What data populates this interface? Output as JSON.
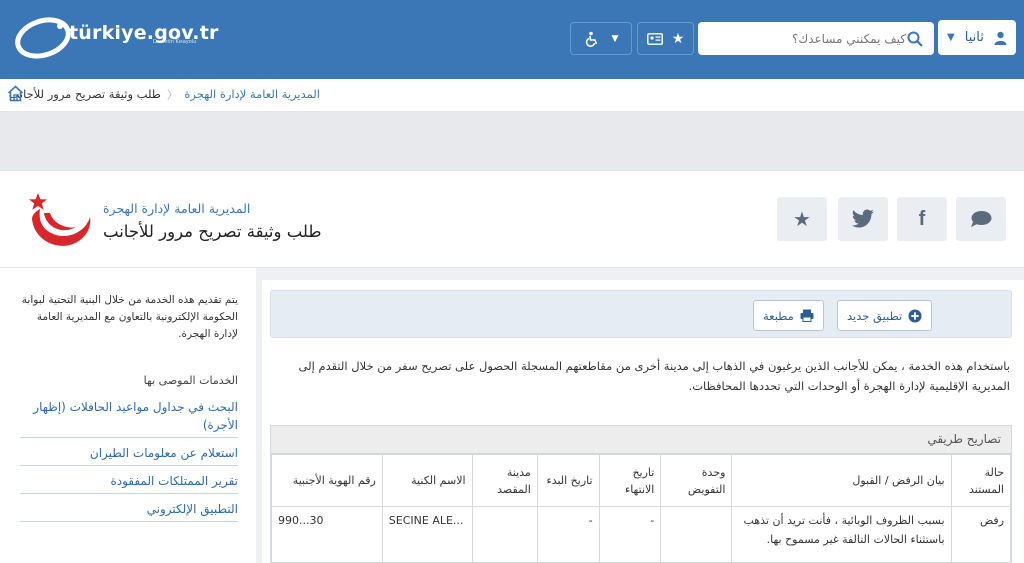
{
  "header": {
    "logo_text": "türkiye.gov.tr",
    "logo_subtitle": "Devletin Kısayolu",
    "language_label": "ثانيا",
    "search_placeholder": "كيف يمكنني مساعدك؟"
  },
  "breadcrumb": {
    "items": [
      "المديرية العامة لإدارة الهجرة",
      "طلب وثيقة تصريح مرور للأجانب"
    ]
  },
  "page": {
    "agency": "المديرية العامة لإدارة الهجرة",
    "title": "طلب وثيقة تصريح مرور للأجانب"
  },
  "sidebar": {
    "description": "يتم تقديم هذه الخدمة من خلال البنية التحتية لبوابة الحكومة الإلكترونية بالتعاون مع المديرية العامة لإدارة الهجرة.",
    "recommended_heading": "الخدمات الموصى بها",
    "links": [
      "البحث في جداول مواعيد الحافلات (إظهار الأجرة)",
      "استعلام عن معلومات الطيران",
      "تقرير الممتلكات المفقودة",
      "التطبيق الإلكتروني"
    ]
  },
  "toolbar": {
    "new_application": "تطبيق جديد",
    "print": "مطبعة"
  },
  "intro_text": "باستخدام هذه الخدمة ، يمكن للأجانب الذين يرغبون في الذهاب إلى مدينة أخرى من مقاطعتهم المسجلة الحصول على تصريح سفر من خلال التقدم إلى المديرية الإقليمية لإدارة الهجرة أو الوحدات التي تحددها المحافظات.",
  "table": {
    "caption": "تصاريح طريقي",
    "columns": [
      "حالة المستند",
      "بيان الرفض / القبول",
      "وحدة التفويض",
      "تاريخ الانتهاء",
      "تاريخ البدء",
      "مدينة المقصد",
      "الاسم الكنية",
      "رقم الهوية الأجنبية"
    ],
    "rows": [
      {
        "status": "رفض",
        "statement": "بسبب الظروف الوبائية ، فأنت تريد أن تذهب باستثناء الحالات التالفة غير مسموح بها.",
        "unit": "",
        "end_date": "-",
        "start_date": "-",
        "destination": "",
        "name": "SECINE ALE...",
        "foreign_id": "990...30"
      }
    ]
  },
  "colors": {
    "brand_blue": "#3b77b6",
    "link_blue": "#2f6aa8",
    "emblem_red": "#d7262c"
  }
}
